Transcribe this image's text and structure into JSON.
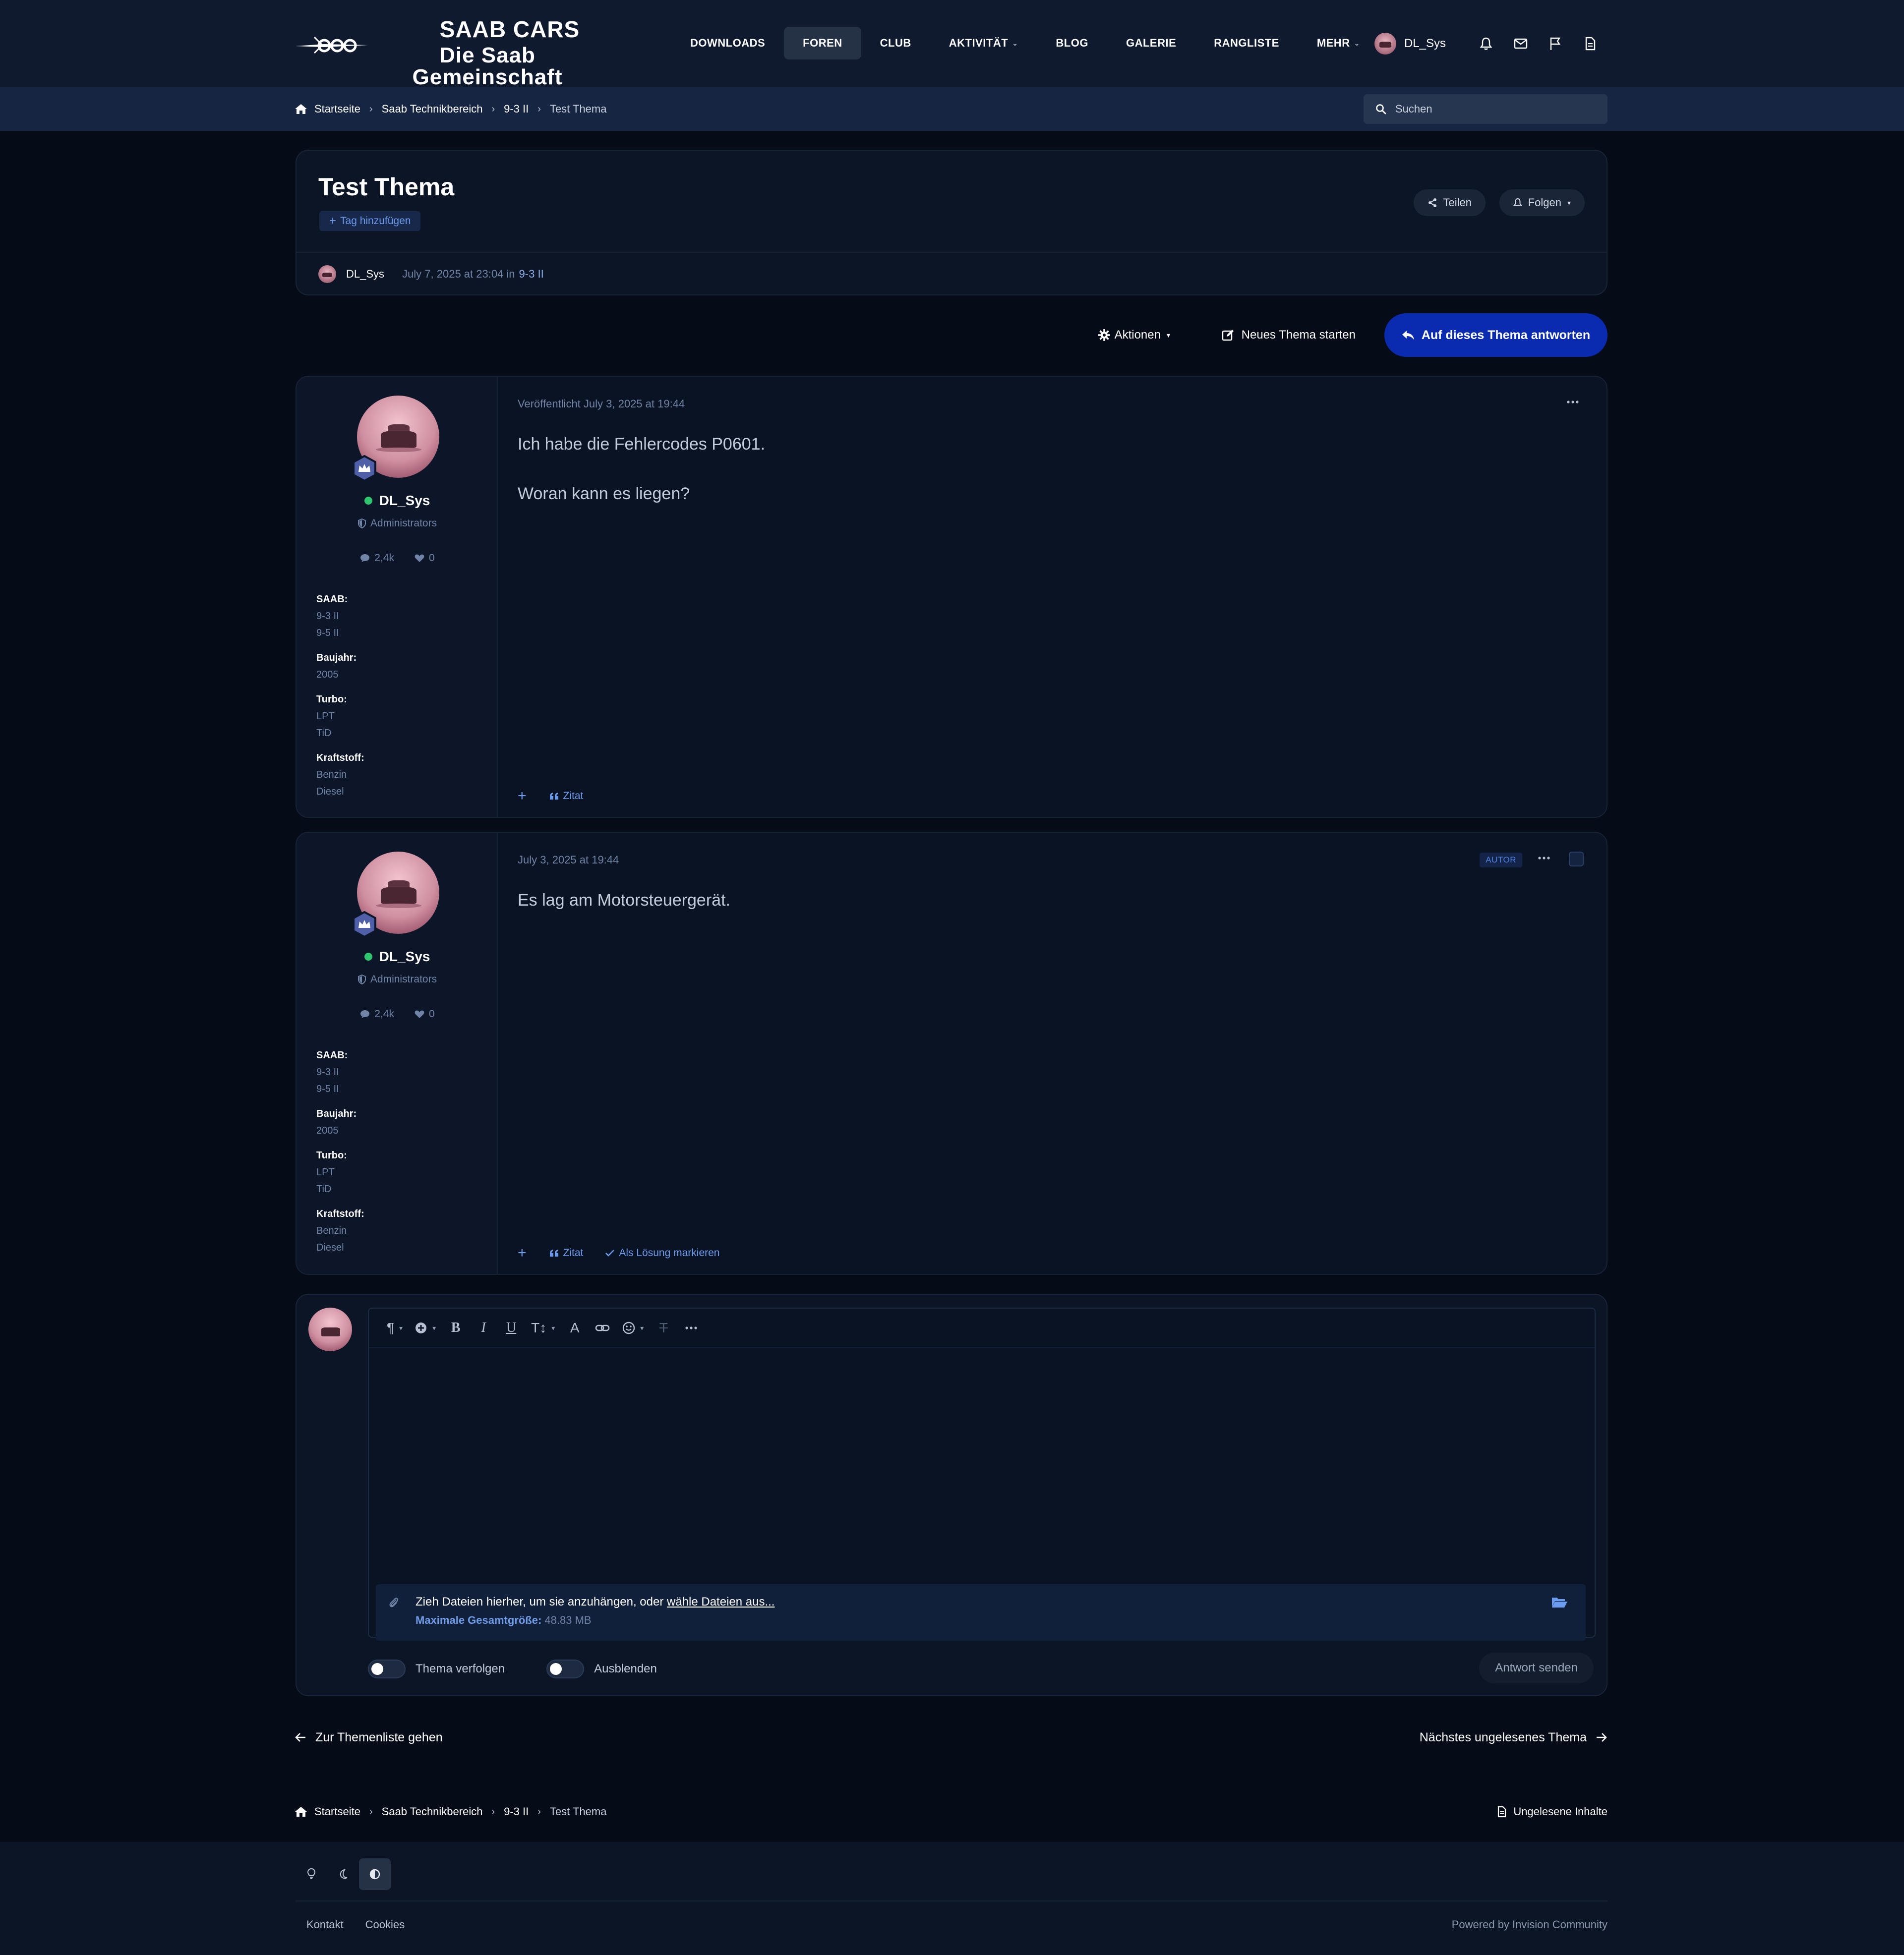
{
  "brand": {
    "line1": "SAAB CARS",
    "line2": "Die Saab Gemeinschaft"
  },
  "nav": {
    "downloads": "DOWNLOADS",
    "foren": "FOREN",
    "club": "CLUB",
    "aktivitaet": "AKTIVITÄT",
    "blog": "BLOG",
    "galerie": "GALERIE",
    "rangliste": "RANGLISTE",
    "mehr": "MEHR"
  },
  "user": {
    "name": "DL_Sys"
  },
  "breadcrumb": {
    "home": "Startseite",
    "section": "Saab Technikbereich",
    "forum": "9-3 II",
    "current": "Test Thema"
  },
  "search": {
    "placeholder": "Suchen"
  },
  "topic": {
    "title": "Test Thema",
    "tag_add": "Tag hinzufügen",
    "share": "Teilen",
    "follow": "Folgen",
    "author": "DL_Sys",
    "date": "July 7, 2025 at 23:04 in",
    "forum": "9-3 II"
  },
  "actions": {
    "aktionen": "Aktionen",
    "new_topic": "Neues Thema starten",
    "reply": "Auf dieses Thema antworten"
  },
  "posts": [
    {
      "author": "DL_Sys",
      "group": "Administrators",
      "posts_count": "2,4k",
      "reputation": "0",
      "fields": {
        "saab_label": "SAAB:",
        "saab_1": "9-3 II",
        "saab_2": "9-5 II",
        "baujahr_label": "Baujahr:",
        "baujahr": "2005",
        "turbo_label": "Turbo:",
        "turbo_1": "LPT",
        "turbo_2": "TiD",
        "kraftstoff_label": "Kraftstoff:",
        "kraftstoff_1": "Benzin",
        "kraftstoff_2": "Diesel"
      },
      "date": "Veröffentlicht July 3, 2025 at 19:44",
      "body_1": "Ich habe die Fehlercodes P0601.",
      "body_2": "Woran kann es liegen?",
      "quote": "Zitat"
    },
    {
      "author": "DL_Sys",
      "group": "Administrators",
      "posts_count": "2,4k",
      "reputation": "0",
      "fields": {
        "saab_label": "SAAB:",
        "saab_1": "9-3 II",
        "saab_2": "9-5 II",
        "baujahr_label": "Baujahr:",
        "baujahr": "2005",
        "turbo_label": "Turbo:",
        "turbo_1": "LPT",
        "turbo_2": "TiD",
        "kraftstoff_label": "Kraftstoff:",
        "kraftstoff_1": "Benzin",
        "kraftstoff_2": "Diesel"
      },
      "date": "July 3, 2025 at 19:44",
      "badge": "AUTOR",
      "body_1": "Es lag am Motorsteuergerät.",
      "quote": "Zitat",
      "solution": "Als Lösung markieren"
    }
  ],
  "editor": {
    "attach_text": "Zieh Dateien hierher, um sie anzuhängen, oder",
    "attach_link": "wähle Dateien aus...",
    "max_label": "Maximale Gesamtgröße:",
    "max_value": "48.83 MB",
    "follow_toggle": "Thema verfolgen",
    "hide_toggle": "Ausblenden",
    "send": "Antwort senden"
  },
  "topic_nav": {
    "prev": "Zur Themenliste gehen",
    "next": "Nächstes ungelesenes Thema"
  },
  "unread": "Ungelesene Inhalte",
  "footer": {
    "contact": "Kontakt",
    "cookies": "Cookies",
    "powered": "Powered by Invision Community"
  },
  "colors": {
    "accent": "#0a2bb0",
    "link": "#6c9cf0",
    "online": "#2ec56c",
    "bg": "#050b17"
  }
}
